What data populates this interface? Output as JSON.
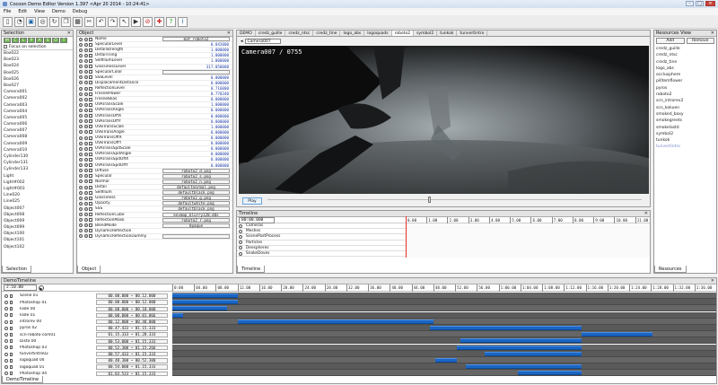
{
  "window": {
    "title": "Cocoon Demo Editor Version 1.397 <Apr 20 2014 - 10:24:41>",
    "min": "–",
    "max": "□",
    "close": "✕"
  },
  "menu": [
    "File",
    "Edit",
    "View",
    "Demo",
    "Debug"
  ],
  "toolbar_icons": [
    "new-icon",
    "open-icon",
    "save-icon",
    "target-icon",
    "refresh-icon",
    "copy-icon",
    "grid-icon",
    "cut-icon",
    "undo-icon",
    "redo-icon",
    "cursor-icon",
    "play-icon",
    "cancel-icon",
    "add-icon",
    "help-icon",
    "info-icon"
  ],
  "selection": {
    "title": "Selection",
    "filter_buttons": [
      "M",
      "C",
      "L",
      "P",
      "A",
      "S",
      "O",
      "T"
    ],
    "focus_label": "Focus on selection",
    "items": [
      "Box022",
      "Box023",
      "Box024",
      "Box025",
      "Box026",
      "Box027",
      "Camera001",
      "Camera002",
      "Camera003",
      "Camera004",
      "Camera005",
      "Camera006",
      "Camera007",
      "Camera008",
      "Camera009",
      "Camera010",
      "Cylinder130",
      "Cylinder131",
      "Cylinder133",
      "Light",
      "Light#002",
      "Light#003",
      "Line020",
      "Line025",
      "Object007",
      "Object008",
      "Object009",
      "Object099",
      "Object100",
      "Object101",
      "Object102"
    ],
    "tab": "Selection"
  },
  "object": {
    "title": "Object",
    "tab": "Object",
    "rows": [
      {
        "name": "Name",
        "value": "mat_roboto2",
        "box": true
      },
      {
        "name": "SpecularLevel",
        "value": "0.842000"
      },
      {
        "name": "DetailStrength",
        "value": "1.000000"
      },
      {
        "name": "DetailTiling",
        "value": "1.000000"
      },
      {
        "name": "SelfIllumLevel",
        "value": "1.000000"
      },
      {
        "name": "GlossinessLevel",
        "value": "317.050000"
      },
      {
        "name": "SpecularColor",
        "value": "",
        "box": true
      },
      {
        "name": "SSSLevel",
        "value": "0.000000"
      },
      {
        "name": "DisplacementDistance",
        "value": "0.000000"
      },
      {
        "name": "ReflectionLevel",
        "value": "0.716000"
      },
      {
        "name": "FresnelPower",
        "value": "0.770340"
      },
      {
        "name": "FresnelBias",
        "value": "0.000000"
      },
      {
        "name": "UVATransScale",
        "value": "1.000000"
      },
      {
        "name": "UVATransAngle",
        "value": "0.000000"
      },
      {
        "name": "UVATransOffX",
        "value": "0.000000"
      },
      {
        "name": "UVATransOffY",
        "value": "0.000000"
      },
      {
        "name": "UVBTransScale",
        "value": "1.000000"
      },
      {
        "name": "UVBTransAngle",
        "value": "0.000000"
      },
      {
        "name": "UVBTransOffX",
        "value": "0.000000"
      },
      {
        "name": "UVBTransOffY",
        "value": "0.000000"
      },
      {
        "name": "UVATransSpdScale",
        "value": "0.000000"
      },
      {
        "name": "UVATransSpdAngle",
        "value": "0.000000"
      },
      {
        "name": "UVATransSpdOffX",
        "value": "0.000000"
      },
      {
        "name": "UVATransSpdOffY",
        "value": "0.000000"
      },
      {
        "name": "Diffuse",
        "value": "roboto2_d.png",
        "box": true
      },
      {
        "name": "Specular",
        "value": "roboto2_s.png",
        "box": true
      },
      {
        "name": "Normal",
        "value": "roboto2_n.png",
        "box": true
      },
      {
        "name": "Detail",
        "value": "defaultnormal.png",
        "box": true
      },
      {
        "name": "SelfIllum",
        "value": "defaultblack.png",
        "box": true
      },
      {
        "name": "Glossiness",
        "value": "roboto2_g.png",
        "box": true
      },
      {
        "name": "Opacity",
        "value": "defaultwhite.png",
        "box": true
      },
      {
        "name": "SSS",
        "value": "defaultblack.png",
        "box": true
      },
      {
        "name": "ReflectionCube",
        "value": "envmap_blurry128.dds",
        "box": true
      },
      {
        "name": "ReflectionMask",
        "value": "roboto2_r.png",
        "box": true
      },
      {
        "name": "BlendMode",
        "value": "Opaque",
        "box": true
      },
      {
        "name": "DynamicReflection",
        "value": "",
        "box": false
      },
      {
        "name": "DynamicReflectionDummy",
        "value": "",
        "box": true
      }
    ]
  },
  "viewport": {
    "tabs": [
      "DEMO",
      "credz_guille",
      "credz_ntsc",
      "credz_tine",
      "logo_abs",
      "logoquads",
      "roboto2",
      "symbol2",
      "tunkok",
      "tunvertintro"
    ],
    "active_tab": "roboto2",
    "camera_select": "Camera007",
    "overlay": "Camera007 / 0755",
    "play_label": "Play"
  },
  "timeline": {
    "title": "Timeline",
    "time_value": "00:00.000",
    "ticks": [
      "0.00",
      "1.00",
      "2.00",
      "3.00",
      "4.00",
      "5.00",
      "6.00",
      "7.00",
      "8.00",
      "9.00",
      "10.00",
      "11.00"
    ],
    "tracks": [
      "Cameras",
      "Meshes",
      "ScenePostProcess",
      "Particles",
      "Deespheres",
      "SnakeDoves"
    ],
    "tab": "Timeline"
  },
  "resources": {
    "title": "Resources View",
    "add_label": "Add",
    "remove_label": "Remove",
    "items": [
      "credz_guille",
      "credz_ntsc",
      "credz_tine",
      "logo_abs",
      "occlusphere",
      "pilltemflower",
      "pyros",
      "roboto2",
      "scn_introrev2",
      "scn_kokuen",
      "smoked_boxy",
      "smokegreets",
      "smokelastd",
      "symbol2",
      "tunkok",
      "tunvertintro"
    ],
    "tab": "Resources"
  },
  "demo_timeline": {
    "title": "DemoTimeline",
    "time_value": "2:10.00",
    "ticks": [
      "0:00",
      "04.00",
      "08.00",
      "12.00",
      "16.00",
      "20.00",
      "24.00",
      "28.00",
      "32.00",
      "36.00",
      "40.00",
      "44.00",
      "48.00",
      "52.00",
      "56.00",
      "1:00.00",
      "1:04.00",
      "1:08.00",
      "1:12.00",
      "1:16.00",
      "1:20.00",
      "1:24.00",
      "1:28.00",
      "1:32.00",
      "1:36.00"
    ],
    "tab": "DemoTimeline",
    "rows": [
      {
        "name": "Scene 01",
        "time": "00.00.000 ~ 00.12.000",
        "start": 0.0,
        "end": 12.0
      },
      {
        "name": "Photoshop 01",
        "time": "00.00.000 ~ 00.12.000",
        "start": 0.0,
        "end": 12.0
      },
      {
        "name": "Fade 00",
        "time": "00.00.000 ~ 00.10.000",
        "start": 0.0,
        "end": 10.0
      },
      {
        "name": "Fade 01",
        "time": "00.00.000 ~ 00.01.066",
        "start": 0.0,
        "end": 2.0
      },
      {
        "name": "introrev 00",
        "time": "00.12.000 ~ 00.48.000",
        "start": 12.0,
        "end": 48.0
      },
      {
        "name": "pyros 02",
        "time": "00.47.433 ~ 01.15.333",
        "start": 47.4,
        "end": 75.3
      },
      {
        "name": "scn-roboto-com01",
        "time": "01.15.333 ~ 01.28.333",
        "start": 75.3,
        "end": 88.3
      },
      {
        "name": "Disto 00",
        "time": "00.53.000 ~ 01.15.333",
        "start": 53.0,
        "end": 75.3
      },
      {
        "name": "Photoshop 03",
        "time": "00.52.300 ~ 01.15.266",
        "start": 52.3,
        "end": 75.3
      },
      {
        "name": "tunvertintro02",
        "time": "00.57.433 ~ 01.15.333",
        "start": 57.4,
        "end": 75.3
      },
      {
        "name": "logoquad 00",
        "time": "00.48.300 ~ 00.52.300",
        "start": 48.3,
        "end": 52.3
      },
      {
        "name": "logoquad 01",
        "time": "00.54.000 ~ 01.15.333",
        "start": 54.0,
        "end": 75.3
      },
      {
        "name": "Photoshop 04",
        "time": "01.03.533 ~ 01.15.333",
        "start": 63.5,
        "end": 75.3
      }
    ]
  }
}
